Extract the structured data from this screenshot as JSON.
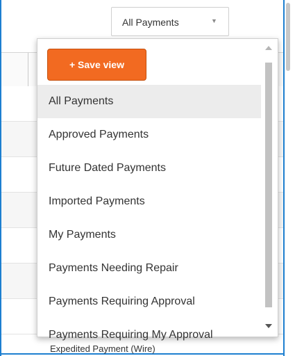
{
  "filter_select": {
    "value": "All Payments",
    "arrow_icon": "caret-down-icon"
  },
  "dropdown": {
    "save_view_label": "+ Save view",
    "options": [
      {
        "label": "All Payments",
        "selected": true
      },
      {
        "label": "Approved Payments"
      },
      {
        "label": "Future Dated Payments"
      },
      {
        "label": "Imported Payments"
      },
      {
        "label": "My Payments"
      },
      {
        "label": "Payments Needing Repair"
      },
      {
        "label": "Payments Requiring Approval"
      },
      {
        "label": "Payments Requiring My Approval"
      }
    ]
  },
  "background_table": {
    "partial_row_text": "Expedited Payment (Wire)"
  },
  "colors": {
    "accent": "#f26a21",
    "frame": "#1d7fd0",
    "selected_bg": "#ececec"
  }
}
